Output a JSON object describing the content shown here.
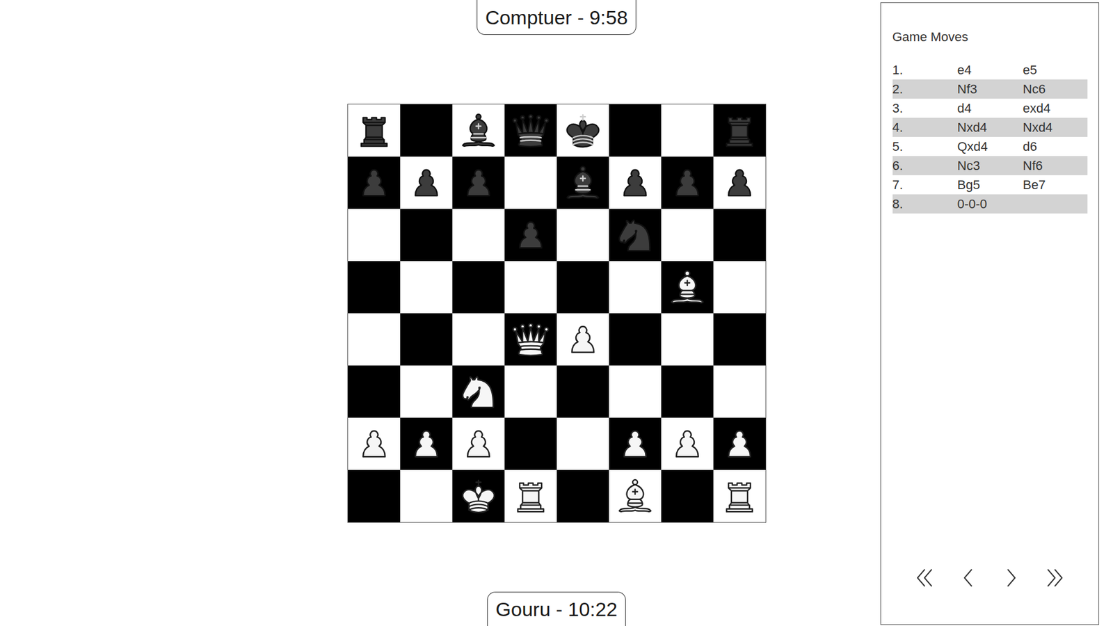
{
  "players": {
    "top": {
      "label": "Comptuer - 9:58"
    },
    "bottom": {
      "label": "Gouru - 10:22"
    }
  },
  "board": {
    "ranks": [
      [
        {
          "piece": "rook",
          "color": "black"
        },
        null,
        {
          "piece": "bishop",
          "color": "black"
        },
        {
          "piece": "queen",
          "color": "black"
        },
        {
          "piece": "king",
          "color": "black"
        },
        null,
        null,
        {
          "piece": "rook",
          "color": "black"
        }
      ],
      [
        {
          "piece": "pawn",
          "color": "black"
        },
        {
          "piece": "pawn",
          "color": "black"
        },
        {
          "piece": "pawn",
          "color": "black"
        },
        null,
        {
          "piece": "bishop",
          "color": "black"
        },
        {
          "piece": "pawn",
          "color": "black"
        },
        {
          "piece": "pawn",
          "color": "black"
        },
        {
          "piece": "pawn",
          "color": "black"
        }
      ],
      [
        null,
        null,
        null,
        {
          "piece": "pawn",
          "color": "black"
        },
        null,
        {
          "piece": "knight",
          "color": "black"
        },
        null,
        null
      ],
      [
        null,
        null,
        null,
        null,
        null,
        null,
        {
          "piece": "bishop",
          "color": "white"
        },
        null
      ],
      [
        null,
        null,
        null,
        {
          "piece": "queen",
          "color": "white"
        },
        {
          "piece": "pawn",
          "color": "white"
        },
        null,
        null,
        null
      ],
      [
        null,
        null,
        {
          "piece": "knight",
          "color": "white"
        },
        null,
        null,
        null,
        null,
        null
      ],
      [
        {
          "piece": "pawn",
          "color": "white"
        },
        {
          "piece": "pawn",
          "color": "white"
        },
        {
          "piece": "pawn",
          "color": "white"
        },
        null,
        null,
        {
          "piece": "pawn",
          "color": "white"
        },
        {
          "piece": "pawn",
          "color": "white"
        },
        {
          "piece": "pawn",
          "color": "white"
        }
      ],
      [
        null,
        null,
        {
          "piece": "king",
          "color": "white"
        },
        {
          "piece": "rook",
          "color": "white"
        },
        null,
        {
          "piece": "bishop",
          "color": "white"
        },
        null,
        {
          "piece": "rook",
          "color": "white"
        }
      ]
    ]
  },
  "moves_panel": {
    "title": "Game Moves",
    "moves": [
      {
        "number": "1.",
        "white": "e4",
        "black": "e5"
      },
      {
        "number": "2.",
        "white": "Nf3",
        "black": "Nc6"
      },
      {
        "number": "3.",
        "white": "d4",
        "black": "exd4"
      },
      {
        "number": "4.",
        "white": "Nxd4",
        "black": "Nxd4"
      },
      {
        "number": "5.",
        "white": "Qxd4",
        "black": "d6"
      },
      {
        "number": "6.",
        "white": "Nc3",
        "black": "Nf6"
      },
      {
        "number": "7.",
        "white": "Bg5",
        "black": "Be7"
      },
      {
        "number": "8.",
        "white": "0-0-0",
        "black": ""
      }
    ]
  }
}
